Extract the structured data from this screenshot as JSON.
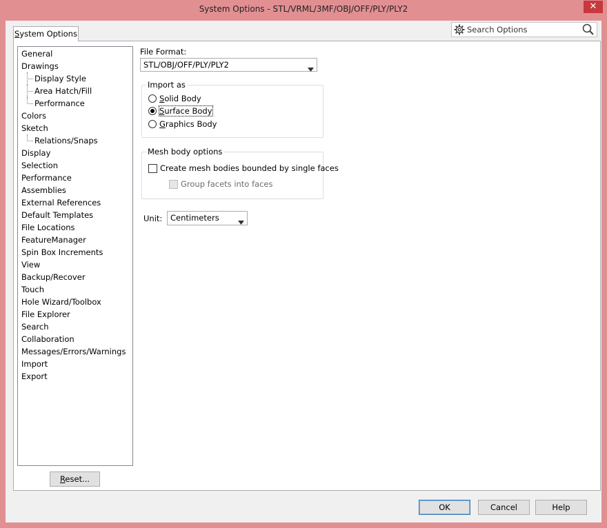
{
  "window": {
    "title": "System Options - STL/VRML/3MF/OBJ/OFF/PLY/PLY2",
    "close_glyph": "✕"
  },
  "tab": {
    "label_prefix": "",
    "mnemonic": "S",
    "label_rest": "ystem Options"
  },
  "search": {
    "placeholder": "Search Options",
    "icons": [
      "gear-icon",
      "search-icon"
    ]
  },
  "tree": {
    "items": [
      {
        "label": "General",
        "level": 0
      },
      {
        "label": "Drawings",
        "level": 0
      },
      {
        "label": "Display Style",
        "level": 1
      },
      {
        "label": "Area Hatch/Fill",
        "level": 1
      },
      {
        "label": "Performance",
        "level": 1
      },
      {
        "label": "Colors",
        "level": 0
      },
      {
        "label": "Sketch",
        "level": 0
      },
      {
        "label": "Relations/Snaps",
        "level": 1
      },
      {
        "label": "Display",
        "level": 0
      },
      {
        "label": "Selection",
        "level": 0
      },
      {
        "label": "Performance",
        "level": 0
      },
      {
        "label": "Assemblies",
        "level": 0
      },
      {
        "label": "External References",
        "level": 0
      },
      {
        "label": "Default Templates",
        "level": 0
      },
      {
        "label": "File Locations",
        "level": 0
      },
      {
        "label": "FeatureManager",
        "level": 0
      },
      {
        "label": "Spin Box Increments",
        "level": 0
      },
      {
        "label": "View",
        "level": 0
      },
      {
        "label": "Backup/Recover",
        "level": 0
      },
      {
        "label": "Touch",
        "level": 0
      },
      {
        "label": "Hole Wizard/Toolbox",
        "level": 0
      },
      {
        "label": "File Explorer",
        "level": 0
      },
      {
        "label": "Search",
        "level": 0
      },
      {
        "label": "Collaboration",
        "level": 0
      },
      {
        "label": "Messages/Errors/Warnings",
        "level": 0
      },
      {
        "label": "Import",
        "level": 0
      },
      {
        "label": "Export",
        "level": 0
      }
    ]
  },
  "reset": {
    "mnemonic": "R",
    "label_rest": "eset..."
  },
  "file_format": {
    "label": "File Format:",
    "value": "STL/OBJ/OFF/PLY/PLY2"
  },
  "import_as": {
    "legend": "Import as",
    "options": [
      {
        "mnemonic": "S",
        "rest": "olid Body",
        "checked": false
      },
      {
        "mnemonic": "S",
        "rest": "urface Body",
        "checked": true
      },
      {
        "mnemonic": "G",
        "rest": "raphics Body",
        "checked": false
      }
    ]
  },
  "mesh": {
    "legend": "Mesh body options",
    "create_label": "Create mesh bodies bounded by single faces",
    "create_checked": false,
    "group_label": "Group facets into faces",
    "group_checked": false,
    "group_enabled": false
  },
  "unit": {
    "label": "Unit:",
    "value": "Centimeters"
  },
  "buttons": {
    "ok": "OK",
    "cancel": "Cancel",
    "help": "Help"
  }
}
